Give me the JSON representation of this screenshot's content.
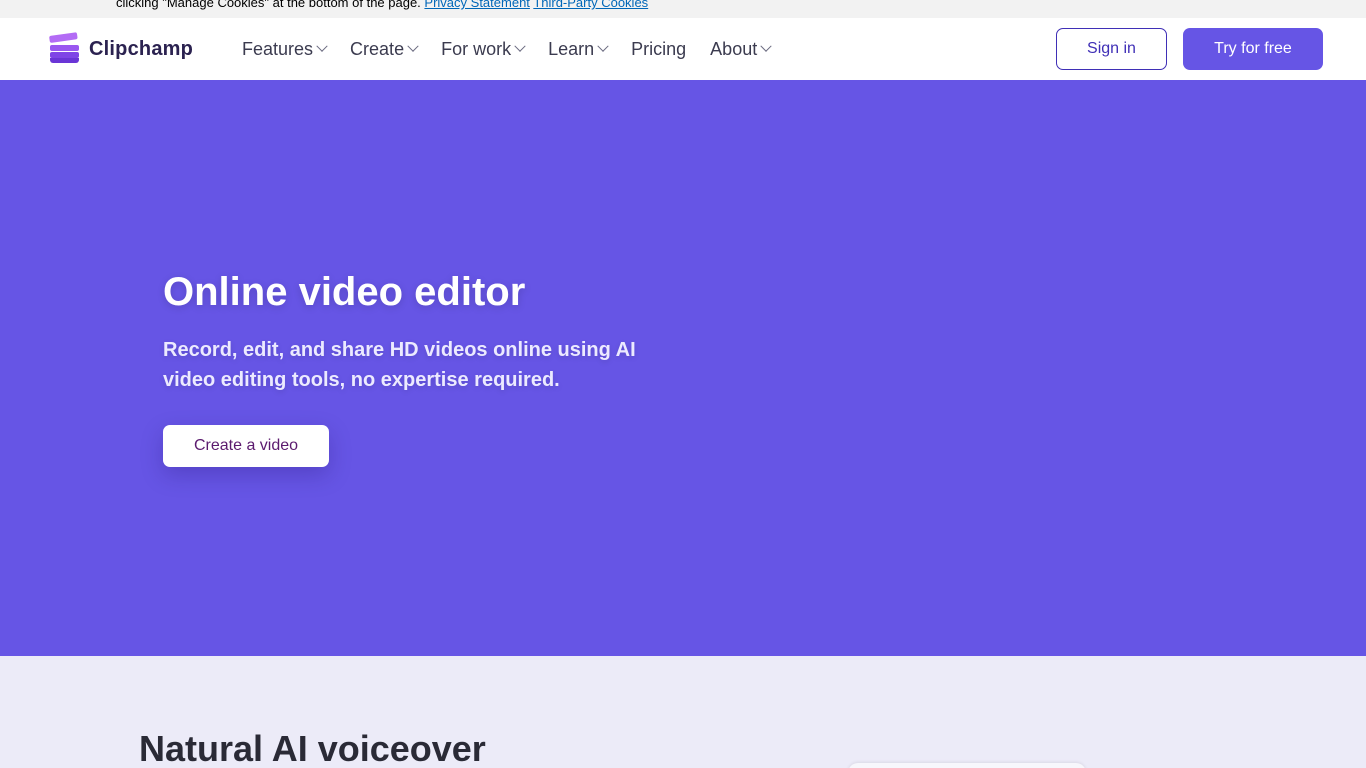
{
  "cookie_banner": {
    "text": "clicking \"Manage Cookies\" at the bottom of the page.",
    "links": [
      "Privacy Statement",
      "Third-Party Cookies"
    ]
  },
  "header": {
    "brand": "Clipchamp",
    "nav": [
      {
        "label": "Features",
        "has_dropdown": true
      },
      {
        "label": "Create",
        "has_dropdown": true
      },
      {
        "label": "For work",
        "has_dropdown": true
      },
      {
        "label": "Learn",
        "has_dropdown": true
      },
      {
        "label": "Pricing",
        "has_dropdown": false
      },
      {
        "label": "About",
        "has_dropdown": true
      }
    ],
    "sign_in": "Sign in",
    "try_free": "Try for free"
  },
  "hero": {
    "title": "Online video editor",
    "subtitle": "Record, edit, and share HD videos online using AI video editing tools, no expertise required.",
    "cta": "Create a video"
  },
  "section2": {
    "title": "Natural AI voiceover"
  },
  "colors": {
    "accent": "#6655e5",
    "brand_text": "#2b2250",
    "signin_border": "#3f2fb6",
    "section_bg": "#ecebf8"
  }
}
